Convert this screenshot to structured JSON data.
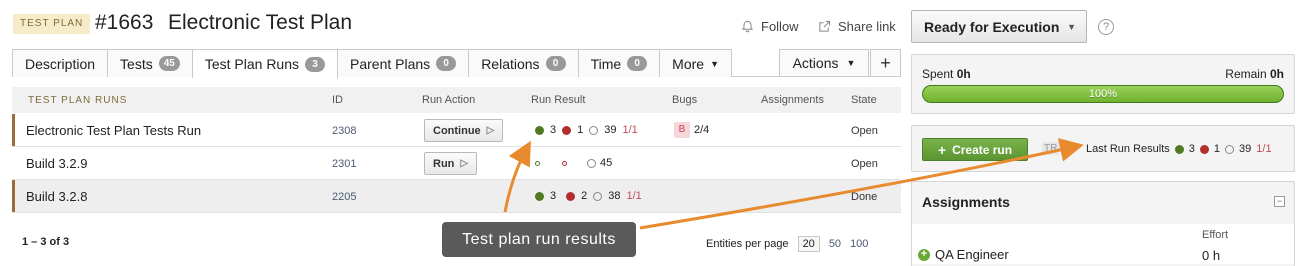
{
  "header": {
    "badge": "TEST PLAN",
    "number": "#1663",
    "title": "Electronic Test Plan",
    "follow": "Follow",
    "share": "Share link"
  },
  "tabs": [
    {
      "label": "Description",
      "count": null
    },
    {
      "label": "Tests",
      "count": "45"
    },
    {
      "label": "Test Plan Runs",
      "count": "3"
    },
    {
      "label": "Parent Plans",
      "count": "0"
    },
    {
      "label": "Relations",
      "count": "0"
    },
    {
      "label": "Time",
      "count": "0"
    },
    {
      "label": "More",
      "count": null
    }
  ],
  "tab_actions": "Actions",
  "table": {
    "columns": [
      "TEST PLAN RUNS",
      "ID",
      "Run Action",
      "Run Result",
      "Bugs",
      "Assignments",
      "State"
    ],
    "rows": [
      {
        "name": "Electronic Test Plan Tests Run",
        "id": "2308",
        "action": "Continue",
        "passed": "3",
        "failed": "1",
        "not_run": "39",
        "blocked": "1/1",
        "bug_letter": "B",
        "bugs": "2/4",
        "state": "Open"
      },
      {
        "name": "Build 3.2.9",
        "id": "2301",
        "action": "Run",
        "passed": "",
        "failed": "",
        "not_run": "45",
        "blocked": "",
        "bug_letter": "",
        "bugs": "",
        "state": "Open"
      },
      {
        "name": "Build 3.2.8",
        "id": "2205",
        "action": "",
        "passed": "3",
        "failed": "2",
        "not_run": "38",
        "blocked": "1/1",
        "bug_letter": "",
        "bugs": "",
        "state": "Done"
      }
    ],
    "range": "1 – 3 of 3",
    "per_page_label": "Entities per page",
    "per_page_options": [
      "20",
      "50",
      "100"
    ]
  },
  "tooltip": "Test plan run results",
  "right": {
    "state_button": "Ready for Execution",
    "help": "?",
    "spent_label": "Spent",
    "spent_value": "0h",
    "remain_label": "Remain",
    "remain_value": "0h",
    "progress": "100%",
    "create_run": "Create run",
    "tr_tag": "TR",
    "last_run_label": "Last Run Results",
    "last_passed": "3",
    "last_failed": "1",
    "last_not_run": "39",
    "last_blocked": "1/1",
    "assignments_title": "Assignments",
    "effort_label": "Effort",
    "role": "QA Engineer",
    "role_effort": "0 h"
  },
  "colors": {
    "accent_green": "#6fb22f",
    "fail_red": "#b22d2d",
    "pass_green": "#4f7a22",
    "arrow_orange": "#e88a2e",
    "row_marker": "#9a6b3c"
  }
}
